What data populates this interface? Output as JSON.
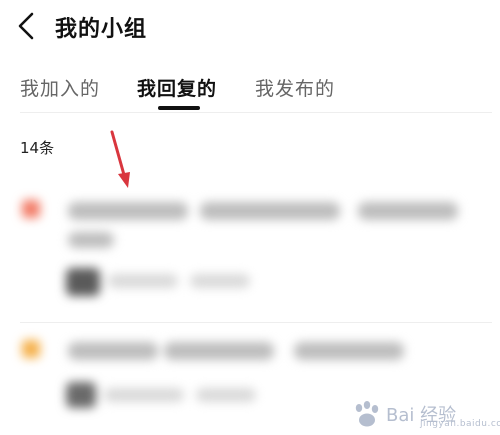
{
  "header": {
    "back_icon": "chevron-left-icon",
    "title": "我的小组"
  },
  "tabs": [
    {
      "label": "我加入的",
      "active": false
    },
    {
      "label": "我回复的",
      "active": true
    },
    {
      "label": "我发布的",
      "active": false
    }
  ],
  "list": {
    "count_label": "14条"
  },
  "annotation": {
    "arrow_color": "#d9363e"
  },
  "watermark": {
    "logo_icon": "baidu-paw-icon",
    "text": "Bai 经验",
    "subtext": "jingyan.baidu.com"
  }
}
